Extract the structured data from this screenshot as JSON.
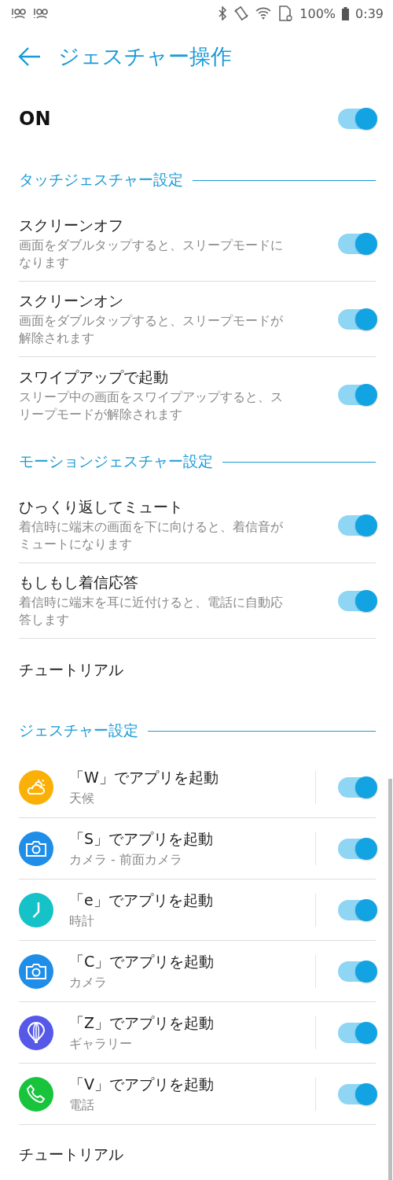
{
  "status_bar": {
    "battery": "100%",
    "time": "0:39"
  },
  "header": {
    "title": "ジェスチャー操作"
  },
  "master": {
    "label": "ON",
    "on": true
  },
  "sections": [
    {
      "title": "タッチジェスチャー設定",
      "items": [
        {
          "kind": "toggle",
          "title": "スクリーンオフ",
          "subtitle": "画面をダブルタップすると、スリープモードになります",
          "on": true
        },
        {
          "kind": "toggle",
          "title": "スクリーンオン",
          "subtitle": "画面をダブルタップすると、スリープモードが解除されます",
          "on": true
        },
        {
          "kind": "toggle",
          "title": "スワイプアップで起動",
          "subtitle": "スリープ中の画面をスワイプアップすると、スリープモードが解除されます",
          "on": true
        }
      ]
    },
    {
      "title": "モーションジェスチャー設定",
      "items": [
        {
          "kind": "toggle",
          "title": "ひっくり返してミュート",
          "subtitle": "着信時に端末の画面を下に向けると、着信音がミュートになります",
          "on": true
        },
        {
          "kind": "toggle",
          "title": "もしもし着信応答",
          "subtitle": "着信時に端末を耳に近付けると、電話に自動応答します",
          "on": true
        },
        {
          "kind": "link",
          "title": "チュートリアル"
        }
      ]
    },
    {
      "title": "ジェスチャー設定",
      "items": [
        {
          "kind": "weather",
          "color": "#fbb008",
          "title": "「W」でアプリを起動",
          "subtitle": "天候",
          "on": true
        },
        {
          "kind": "camera",
          "color": "#1f8ee8",
          "title": "「S」でアプリを起動",
          "subtitle": "カメラ - 前面カメラ",
          "on": true
        },
        {
          "kind": "clock",
          "color": "#14c2c8",
          "title": "「e」でアプリを起動",
          "subtitle": "時計",
          "on": true
        },
        {
          "kind": "camera",
          "color": "#1f8ee8",
          "title": "「C」でアプリを起動",
          "subtitle": "カメラ",
          "on": true
        },
        {
          "kind": "balloon",
          "color": "#5658e8",
          "title": "「Z」でアプリを起動",
          "subtitle": "ギャラリー",
          "on": true
        },
        {
          "kind": "phone",
          "color": "#17c43c",
          "title": "「V」でアプリを起動",
          "subtitle": "電話",
          "on": true
        },
        {
          "kind": "link",
          "title": "チュートリアル"
        }
      ]
    }
  ]
}
